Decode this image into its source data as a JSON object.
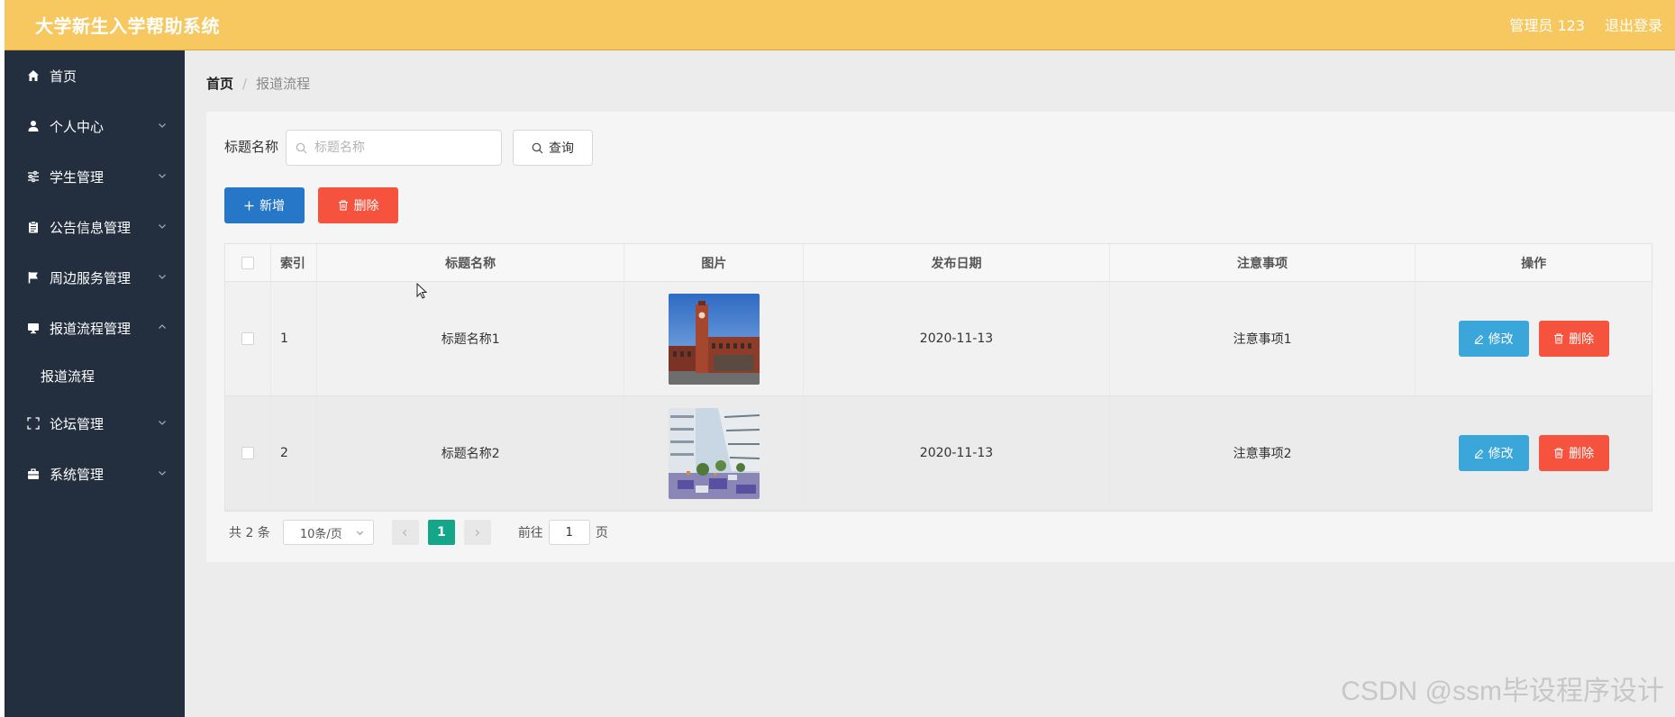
{
  "header": {
    "app_title": "大学新生入学帮助系统",
    "user_label": "管理员 123",
    "logout_label": "退出登录"
  },
  "sidebar": {
    "items": [
      {
        "label": "首页",
        "icon": "home-icon",
        "expandable": false
      },
      {
        "label": "个人中心",
        "icon": "user-icon",
        "expandable": true
      },
      {
        "label": "学生管理",
        "icon": "sliders-icon",
        "expandable": true
      },
      {
        "label": "公告信息管理",
        "icon": "clipboard-icon",
        "expandable": true
      },
      {
        "label": "周边服务管理",
        "icon": "flag-icon",
        "expandable": true
      },
      {
        "label": "报道流程管理",
        "icon": "monitor-icon",
        "expandable": true,
        "expanded": true
      },
      {
        "label": "论坛管理",
        "icon": "fullscreen-icon",
        "expandable": true
      },
      {
        "label": "系统管理",
        "icon": "briefcase-icon",
        "expandable": true
      }
    ],
    "submenu": [
      {
        "label": "报道流程"
      }
    ]
  },
  "breadcrumb": {
    "home": "首页",
    "separator": "/",
    "current": "报道流程"
  },
  "search": {
    "label": "标题名称",
    "placeholder": "标题名称",
    "value": "",
    "query_button": "查询"
  },
  "actions": {
    "add_button": "新增",
    "delete_button": "删除"
  },
  "table": {
    "columns": [
      "",
      "索引",
      "标题名称",
      "图片",
      "发布日期",
      "注意事项",
      "操作"
    ],
    "rows": [
      {
        "index": "1",
        "title": "标题名称1",
        "image": "campus-clock-tower",
        "date": "2020-11-13",
        "note": "注意事项1",
        "edit": "修改",
        "delete": "删除"
      },
      {
        "index": "2",
        "title": "标题名称2",
        "image": "campus-courtyard",
        "date": "2020-11-13",
        "note": "注意事项2",
        "edit": "修改",
        "delete": "删除"
      }
    ]
  },
  "pagination": {
    "total": "共 2 条",
    "page_size": "10条/页",
    "current_page": "1",
    "goto_label": "前往",
    "goto_value": "1",
    "page_suffix": "页"
  },
  "watermark": "CSDN @ssm毕设程序设计",
  "colors": {
    "topbar": "#f6c85f",
    "sidebar": "#232e3f",
    "primary": "#2677c7",
    "danger": "#f5533d",
    "edit": "#3aa6d9",
    "pager_active": "#13a689"
  }
}
